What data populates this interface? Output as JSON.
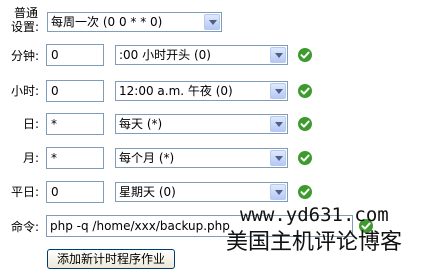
{
  "labels": {
    "common_line1": "普通",
    "common_line2": "设置:",
    "minute": "分钟:",
    "hour": "小时:",
    "day": "日:",
    "month": "月:",
    "weekday": "平日:",
    "command": "命令:"
  },
  "common_select": "每周一次 (0 0 * * 0)",
  "rows": {
    "minute": {
      "input": "0",
      "select": ":00 小时开头 (0)"
    },
    "hour": {
      "input": "0",
      "select": "12:00 a.m. 午夜 (0)"
    },
    "day": {
      "input": "*",
      "select": "每天 (*)"
    },
    "month": {
      "input": "*",
      "select": "每个月 (*)"
    },
    "weekday": {
      "input": "0",
      "select": "星期天 (0)"
    }
  },
  "command_input": "php -q /home/xxx/backup.php",
  "submit_button": "添加新计时程序作业",
  "watermark": {
    "url": "www.yd631.com",
    "text": "美国主机评论博客"
  },
  "colors": {
    "check": "#3d9b2e",
    "border": "#7f9db9"
  },
  "icons": {
    "status": "check-circle-icon",
    "dropdown": "chevron-down-icon"
  }
}
